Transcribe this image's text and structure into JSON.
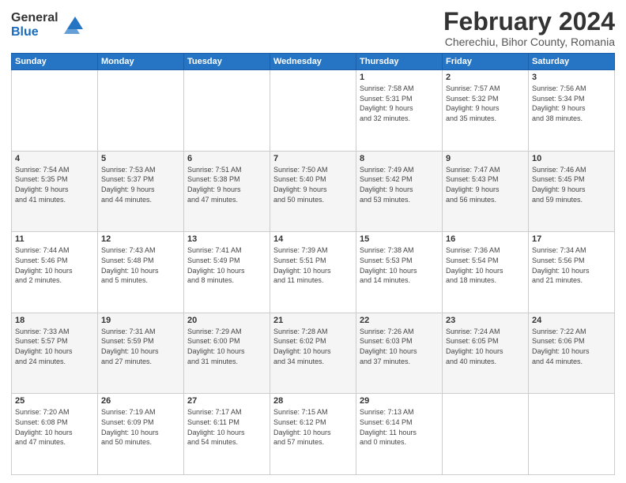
{
  "logo": {
    "line1": "General",
    "line2": "Blue"
  },
  "title": "February 2024",
  "subtitle": "Cherechiu, Bihor County, Romania",
  "headers": [
    "Sunday",
    "Monday",
    "Tuesday",
    "Wednesday",
    "Thursday",
    "Friday",
    "Saturday"
  ],
  "weeks": [
    [
      {
        "day": "",
        "info": ""
      },
      {
        "day": "",
        "info": ""
      },
      {
        "day": "",
        "info": ""
      },
      {
        "day": "",
        "info": ""
      },
      {
        "day": "1",
        "info": "Sunrise: 7:58 AM\nSunset: 5:31 PM\nDaylight: 9 hours\nand 32 minutes."
      },
      {
        "day": "2",
        "info": "Sunrise: 7:57 AM\nSunset: 5:32 PM\nDaylight: 9 hours\nand 35 minutes."
      },
      {
        "day": "3",
        "info": "Sunrise: 7:56 AM\nSunset: 5:34 PM\nDaylight: 9 hours\nand 38 minutes."
      }
    ],
    [
      {
        "day": "4",
        "info": "Sunrise: 7:54 AM\nSunset: 5:35 PM\nDaylight: 9 hours\nand 41 minutes."
      },
      {
        "day": "5",
        "info": "Sunrise: 7:53 AM\nSunset: 5:37 PM\nDaylight: 9 hours\nand 44 minutes."
      },
      {
        "day": "6",
        "info": "Sunrise: 7:51 AM\nSunset: 5:38 PM\nDaylight: 9 hours\nand 47 minutes."
      },
      {
        "day": "7",
        "info": "Sunrise: 7:50 AM\nSunset: 5:40 PM\nDaylight: 9 hours\nand 50 minutes."
      },
      {
        "day": "8",
        "info": "Sunrise: 7:49 AM\nSunset: 5:42 PM\nDaylight: 9 hours\nand 53 minutes."
      },
      {
        "day": "9",
        "info": "Sunrise: 7:47 AM\nSunset: 5:43 PM\nDaylight: 9 hours\nand 56 minutes."
      },
      {
        "day": "10",
        "info": "Sunrise: 7:46 AM\nSunset: 5:45 PM\nDaylight: 9 hours\nand 59 minutes."
      }
    ],
    [
      {
        "day": "11",
        "info": "Sunrise: 7:44 AM\nSunset: 5:46 PM\nDaylight: 10 hours\nand 2 minutes."
      },
      {
        "day": "12",
        "info": "Sunrise: 7:43 AM\nSunset: 5:48 PM\nDaylight: 10 hours\nand 5 minutes."
      },
      {
        "day": "13",
        "info": "Sunrise: 7:41 AM\nSunset: 5:49 PM\nDaylight: 10 hours\nand 8 minutes."
      },
      {
        "day": "14",
        "info": "Sunrise: 7:39 AM\nSunset: 5:51 PM\nDaylight: 10 hours\nand 11 minutes."
      },
      {
        "day": "15",
        "info": "Sunrise: 7:38 AM\nSunset: 5:53 PM\nDaylight: 10 hours\nand 14 minutes."
      },
      {
        "day": "16",
        "info": "Sunrise: 7:36 AM\nSunset: 5:54 PM\nDaylight: 10 hours\nand 18 minutes."
      },
      {
        "day": "17",
        "info": "Sunrise: 7:34 AM\nSunset: 5:56 PM\nDaylight: 10 hours\nand 21 minutes."
      }
    ],
    [
      {
        "day": "18",
        "info": "Sunrise: 7:33 AM\nSunset: 5:57 PM\nDaylight: 10 hours\nand 24 minutes."
      },
      {
        "day": "19",
        "info": "Sunrise: 7:31 AM\nSunset: 5:59 PM\nDaylight: 10 hours\nand 27 minutes."
      },
      {
        "day": "20",
        "info": "Sunrise: 7:29 AM\nSunset: 6:00 PM\nDaylight: 10 hours\nand 31 minutes."
      },
      {
        "day": "21",
        "info": "Sunrise: 7:28 AM\nSunset: 6:02 PM\nDaylight: 10 hours\nand 34 minutes."
      },
      {
        "day": "22",
        "info": "Sunrise: 7:26 AM\nSunset: 6:03 PM\nDaylight: 10 hours\nand 37 minutes."
      },
      {
        "day": "23",
        "info": "Sunrise: 7:24 AM\nSunset: 6:05 PM\nDaylight: 10 hours\nand 40 minutes."
      },
      {
        "day": "24",
        "info": "Sunrise: 7:22 AM\nSunset: 6:06 PM\nDaylight: 10 hours\nand 44 minutes."
      }
    ],
    [
      {
        "day": "25",
        "info": "Sunrise: 7:20 AM\nSunset: 6:08 PM\nDaylight: 10 hours\nand 47 minutes."
      },
      {
        "day": "26",
        "info": "Sunrise: 7:19 AM\nSunset: 6:09 PM\nDaylight: 10 hours\nand 50 minutes."
      },
      {
        "day": "27",
        "info": "Sunrise: 7:17 AM\nSunset: 6:11 PM\nDaylight: 10 hours\nand 54 minutes."
      },
      {
        "day": "28",
        "info": "Sunrise: 7:15 AM\nSunset: 6:12 PM\nDaylight: 10 hours\nand 57 minutes."
      },
      {
        "day": "29",
        "info": "Sunrise: 7:13 AM\nSunset: 6:14 PM\nDaylight: 11 hours\nand 0 minutes."
      },
      {
        "day": "",
        "info": ""
      },
      {
        "day": "",
        "info": ""
      }
    ]
  ]
}
